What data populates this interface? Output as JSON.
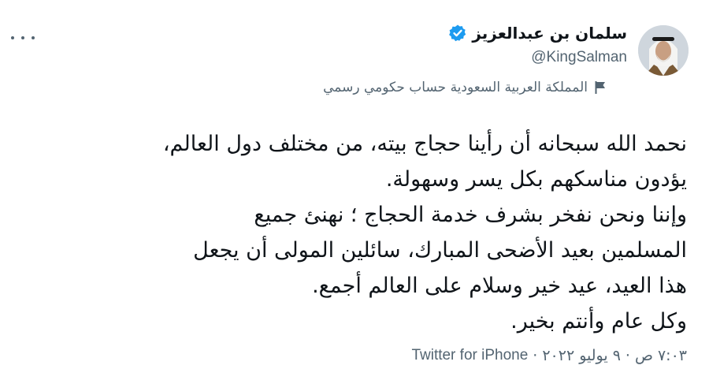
{
  "user": {
    "display_name": "سلمان بن عبدالعزيز",
    "handle": "@KingSalman",
    "label": "المملكة العربية السعودية حساب حكومي رسمي"
  },
  "tweet": {
    "lines": [
      "نحمد الله سبحانه أن رأينا حجاج بيته، من مختلف دول العالم،",
      "يؤدون مناسكهم بكل يسر وسهولة.",
      "وإننا ونحن نفخر بشرف خدمة الحجاج ؛ نهنئ جميع",
      "المسلمين بعيد الأضحى المبارك، سائلين المولى أن يجعل",
      "هذا العيد، عيد خير وسلام على العالم أجمع.",
      "وكل عام وأنتم بخير."
    ],
    "time": "٧:٠٣ ص",
    "date": "٩ يوليو ٢٠٢٢",
    "separator": "·",
    "source": "Twitter for iPhone"
  },
  "colors": {
    "verified": "#1d9bf0",
    "secondary_text": "#536471",
    "primary_text": "#0f1419"
  },
  "icons": {
    "more": "more-horizontal-icon",
    "verified": "verified-badge-icon",
    "flag": "government-flag-icon",
    "avatar": "profile-photo"
  }
}
